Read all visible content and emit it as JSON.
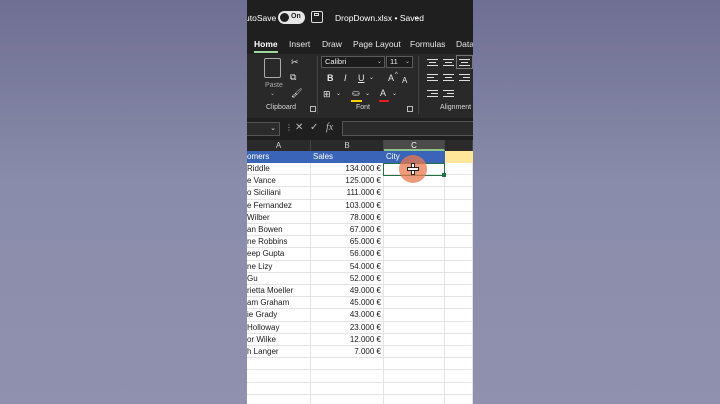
{
  "title_bar": {
    "autosave_label": "utoSave",
    "toggle_state": "On",
    "file_name": "DropDown.xlsx • Saved",
    "chevron": "⌄"
  },
  "tabs": [
    "Home",
    "Insert",
    "Draw",
    "Page Layout",
    "Formulas",
    "Data"
  ],
  "ribbon": {
    "clipboard": {
      "paste_label": "Paste",
      "group_label": "Clipboard"
    },
    "font": {
      "name": "Calibri",
      "size": "11",
      "bold": "B",
      "italic": "I",
      "underline": "U",
      "grow": "A",
      "shrink": "A",
      "font_color": "A",
      "group_label": "Font"
    },
    "alignment": {
      "group_label": "Alignment"
    }
  },
  "formula_bar": {
    "fx": "fx",
    "cancel": "✕",
    "enter": "✓"
  },
  "columns": [
    "A",
    "B",
    "C"
  ],
  "header_row": {
    "a": "omers",
    "b": "Sales",
    "c": "City"
  },
  "rows": [
    {
      "a": "Riddle",
      "b": "134.000 €"
    },
    {
      "a": "e Vance",
      "b": "125.000 €"
    },
    {
      "a": "o Siciliani",
      "b": "111.000 €"
    },
    {
      "a": "e Fernandez",
      "b": "103.000 €"
    },
    {
      "a": "Wilber",
      "b": "78.000 €"
    },
    {
      "a": "an Bowen",
      "b": "67.000 €"
    },
    {
      "a": "ne Robbins",
      "b": "65.000 €"
    },
    {
      "a": "eep Gupta",
      "b": "56.000 €"
    },
    {
      "a": "ne Lizy",
      "b": "54.000 €"
    },
    {
      "a": "Gu",
      "b": "52.000 €"
    },
    {
      "a": "rietta Moeller",
      "b": "49.000 €"
    },
    {
      "a": "am Graham",
      "b": "45.000 €"
    },
    {
      "a": "ie Grady",
      "b": "43.000 €"
    },
    {
      "a": "Holloway",
      "b": "23.000 €"
    },
    {
      "a": "or Wilke",
      "b": "12.000 €"
    },
    {
      "a": "h Langer",
      "b": "7.000 €"
    }
  ],
  "colors": {
    "header_fill": "#3a64b8",
    "highlight_fill": "#ffe699",
    "accent": "#217346"
  }
}
